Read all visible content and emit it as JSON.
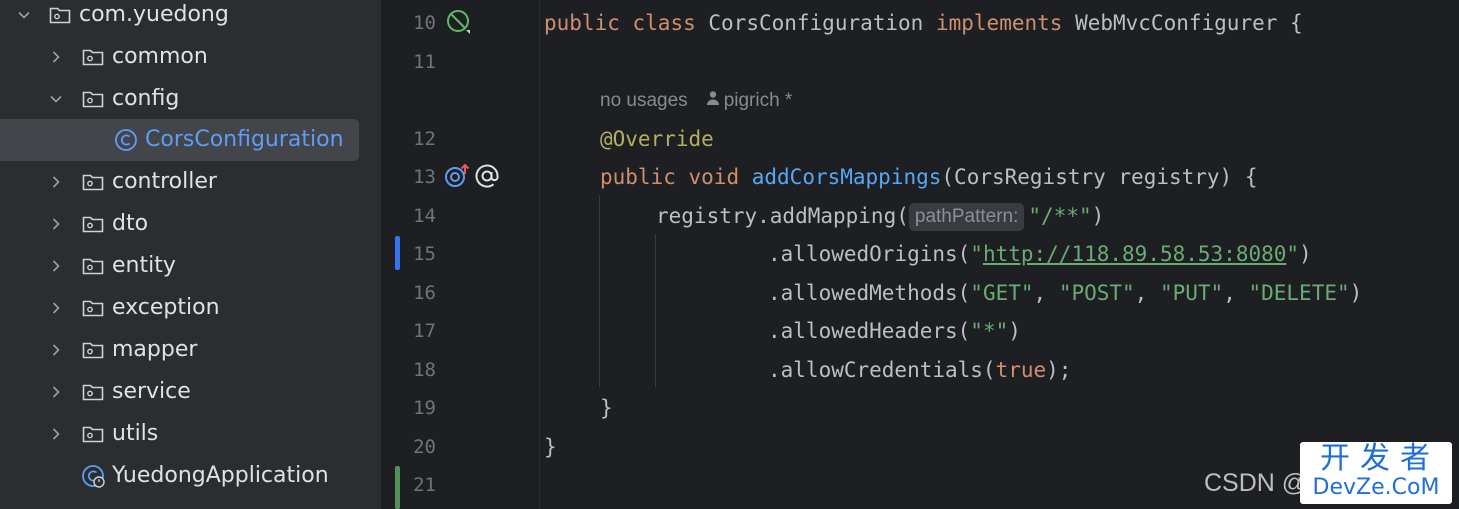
{
  "tree": {
    "items": [
      {
        "label": "com.yuedong",
        "icon": "package-folder-icon",
        "expanded": true
      },
      {
        "label": "common",
        "icon": "package-folder-icon",
        "expanded": false
      },
      {
        "label": "config",
        "icon": "package-folder-icon",
        "expanded": true
      },
      {
        "label": "CorsConfiguration",
        "icon": "class-icon",
        "selected": true
      },
      {
        "label": "controller",
        "icon": "package-folder-icon",
        "expanded": false
      },
      {
        "label": "dto",
        "icon": "package-folder-icon",
        "expanded": false
      },
      {
        "label": "entity",
        "icon": "package-folder-icon",
        "expanded": false
      },
      {
        "label": "exception",
        "icon": "package-folder-icon",
        "expanded": false
      },
      {
        "label": "mapper",
        "icon": "package-folder-icon",
        "expanded": false
      },
      {
        "label": "service",
        "icon": "package-folder-icon",
        "expanded": false
      },
      {
        "label": "utils",
        "icon": "package-folder-icon",
        "expanded": false
      },
      {
        "label": "YuedongApplication",
        "icon": "spring-boot-class-icon"
      }
    ]
  },
  "editor": {
    "line_numbers": [
      "10",
      "11",
      "12",
      "13",
      "14",
      "15",
      "16",
      "17",
      "18",
      "19",
      "20",
      "21"
    ],
    "usage_hint": "no usages",
    "author_hint": "pigrich *",
    "param_hint": "pathPattern:",
    "code": {
      "l10_public": "public",
      "l10_class": "class",
      "l10_name": "CorsConfiguration",
      "l10_implements": "implements",
      "l10_iface": "WebMvcConfigurer {",
      "l12_annotation": "@Override",
      "l13_public": "public",
      "l13_void": "void",
      "l13_method": "addCorsMappings",
      "l13_params": "(CorsRegistry registry) {",
      "l14_call": "registry.addMapping(",
      "l14_arg": "\"/**\"",
      "l14_close": ")",
      "l15_call": ".allowedOrigins(",
      "l15_q1": "\"",
      "l15_url": "http://118.89.58.53:8080",
      "l15_q2": "\"",
      "l15_close": ")",
      "l16_call": ".allowedMethods(",
      "l16_get": "\"GET\"",
      "l16_post": "\"POST\"",
      "l16_put": "\"PUT\"",
      "l16_delete": "\"DELETE\"",
      "comma": ", ",
      "l16_close": ")",
      "l17_call": ".allowedHeaders(",
      "l17_arg": "\"*\"",
      "l17_close": ")",
      "l18_call": ".allowCredentials(",
      "l18_true": "true",
      "l18_close": ");",
      "l19": "}",
      "l20": "}"
    },
    "gutter_icons": [
      "no-implementations-icon",
      "overrides-method-icon",
      "spring-annotation-icon"
    ],
    "colors": {
      "keyword": "#cf8e6d",
      "annotation": "#b3ae60",
      "method": "#56a8f5",
      "string": "#6aab73",
      "modified_marker": "#3574f0",
      "added_marker": "#549159"
    }
  },
  "watermark": {
    "csdn": "CSDN @",
    "brand_cn": "开发者",
    "brand_en": "DevZe.CoM"
  }
}
